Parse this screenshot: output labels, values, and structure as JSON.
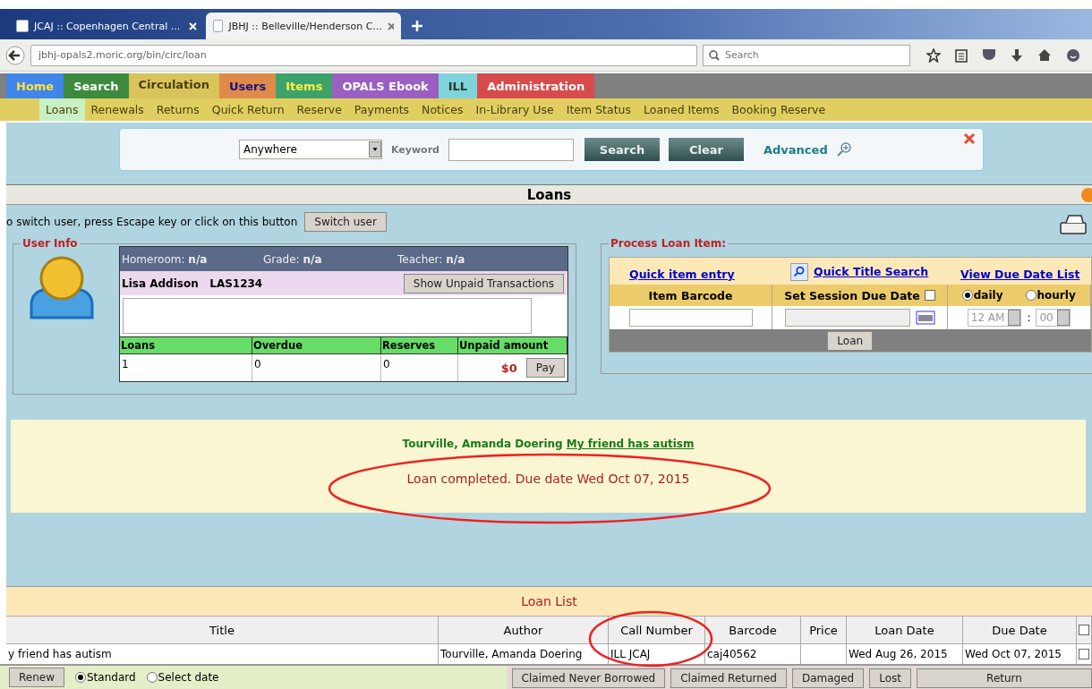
{
  "browser": {
    "tabs": [
      {
        "title": "JCAJ :: Copenhagen Central ...",
        "selected": false
      },
      {
        "title": "JBHJ :: Belleville/Henderson C...",
        "selected": true
      }
    ],
    "url": "jbhj-opals2.moric.org/bin/circ/loan",
    "search_placeholder": "Search"
  },
  "nav": {
    "items": [
      {
        "label": "Home",
        "color": "#3f86e8",
        "selected": false
      },
      {
        "label": "Search",
        "color": "#3d8a3f",
        "selected": false
      },
      {
        "label": "Circulation",
        "color": "#d8c45a",
        "selected": true
      },
      {
        "label": "Users",
        "color": "#df8a4a",
        "selected": false
      },
      {
        "label": "Items",
        "color": "#3ca36a",
        "selected": false
      },
      {
        "label": "OPALS Ebook",
        "color": "#9a5fc0",
        "selected": false
      },
      {
        "label": "ILL",
        "color": "#7fd3dc",
        "selected": false
      },
      {
        "label": "Administration",
        "color": "#d64c4c",
        "selected": false
      }
    ]
  },
  "subnav": {
    "items": [
      {
        "label": "Loans",
        "selected": true
      },
      {
        "label": "Renewals",
        "selected": false
      },
      {
        "label": "Returns",
        "selected": false
      },
      {
        "label": "Quick Return",
        "selected": false
      },
      {
        "label": "Reserve",
        "selected": false
      },
      {
        "label": "Payments",
        "selected": false
      },
      {
        "label": "Notices",
        "selected": false
      },
      {
        "label": "In-Library Use",
        "selected": false
      },
      {
        "label": "Item Status",
        "selected": false
      },
      {
        "label": "Loaned Items",
        "selected": false
      },
      {
        "label": "Booking Reserve",
        "selected": false
      }
    ]
  },
  "search": {
    "scope": "Anywhere",
    "keyword_label": "Keyword",
    "buttons": [
      "Search",
      "Clear"
    ],
    "advanced": "Advanced"
  },
  "page_title": "Loans",
  "switch_hint": "o switch user, press Escape key or click on this button",
  "switch_button": "Switch user",
  "user_info": {
    "legend": "User Info",
    "fields": [
      {
        "label": "Homeroom:",
        "value": "n/a"
      },
      {
        "label": "Grade:",
        "value": "n/a"
      },
      {
        "label": "Teacher:",
        "value": "n/a"
      }
    ],
    "name": "Lisa Addison",
    "user_id": "LAS1234",
    "unpaid_button": "Show Unpaid Transactions",
    "stats": {
      "columns": [
        "Loans",
        "Overdue",
        "Reserves",
        "Unpaid amount"
      ],
      "values": [
        "1",
        "0",
        "0"
      ],
      "unpaid": "$0",
      "pay_button": "Pay"
    }
  },
  "process": {
    "legend": "Process Loan Item:",
    "links": [
      "Quick item entry",
      "Quick Title Search",
      "View Due Date List"
    ],
    "item_barcode": "Item Barcode",
    "session_due_date": "Set Session Due Date",
    "session_checked": false,
    "modes": [
      {
        "label": "daily",
        "selected": true
      },
      {
        "label": "hourly",
        "selected": false
      }
    ],
    "hour": "12 AM",
    "separator": ":",
    "minute": "00",
    "loan_button": "Loan"
  },
  "message": {
    "author": "Tourville, Amanda Doering",
    "title": "My friend has autism",
    "status": "Loan completed. Due date Wed Oct 07, 2015"
  },
  "loan_list": {
    "title": "Loan List",
    "columns": [
      "Title",
      "Author",
      "Call Number",
      "Barcode",
      "Price",
      "Loan Date",
      "Due Date"
    ],
    "all_checked": false,
    "rows": [
      {
        "cells": [
          "y friend has autism",
          "Tourville, Amanda Doering",
          "ILL JCAJ",
          "caj40562",
          "",
          "Wed Aug 26, 2015",
          "Wed Oct 07, 2015"
        ],
        "checked": false
      }
    ]
  },
  "footer": {
    "renew": "Renew",
    "options": [
      {
        "label": "Standard",
        "selected": true
      },
      {
        "label": "Select date",
        "selected": false
      }
    ],
    "buttons": [
      "Claimed Never Borrowed",
      "Claimed Returned",
      "Damaged",
      "Lost"
    ],
    "return": "Return"
  }
}
